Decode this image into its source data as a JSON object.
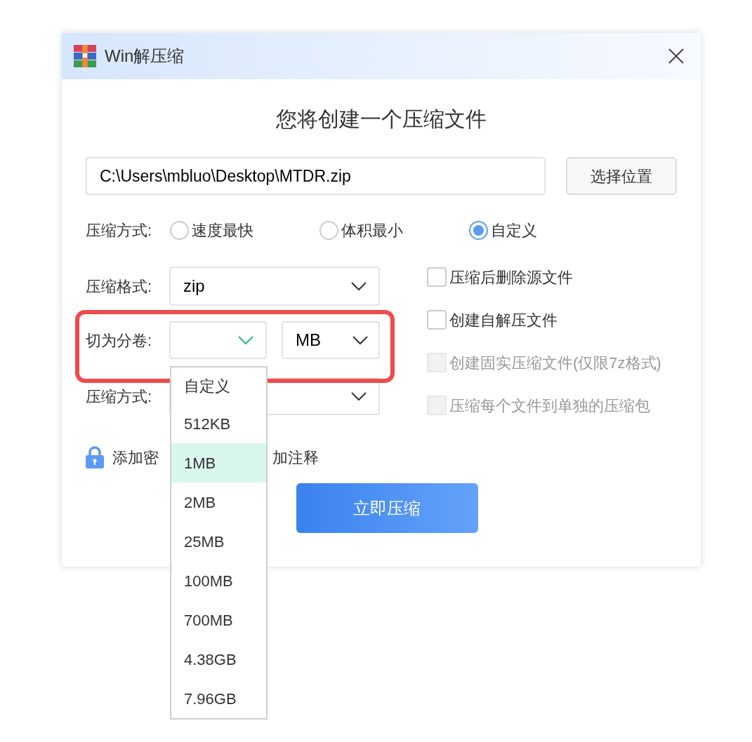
{
  "window": {
    "title": "Win解压缩"
  },
  "heading": "您将创建一个压缩文件",
  "path_field": {
    "value": "C:\\Users\\mbluo\\Desktop\\MTDR.zip"
  },
  "choose_button": "选择位置",
  "mode": {
    "label": "压缩方式:",
    "options": [
      {
        "label": "速度最快",
        "selected": false
      },
      {
        "label": "体积最小",
        "selected": false
      },
      {
        "label": "自定义",
        "selected": true
      }
    ]
  },
  "format": {
    "label": "压缩格式:",
    "value": "zip"
  },
  "split": {
    "label": "切为分卷:",
    "size_open": true,
    "unit": "MB"
  },
  "method": {
    "label": "压缩方式:"
  },
  "checkboxes": [
    {
      "label": "压缩后删除源文件",
      "checked": false,
      "disabled": false
    },
    {
      "label": "创建自解压文件",
      "checked": false,
      "disabled": false
    },
    {
      "label": "创建固实压缩文件(仅限7z格式)",
      "checked": false,
      "disabled": true
    },
    {
      "label": "压缩每个文件到单独的压缩包",
      "checked": false,
      "disabled": true
    }
  ],
  "password_link": "添加密",
  "comment_link": "加注释",
  "compress_button": "立即压缩",
  "split_options": [
    {
      "label": "自定义",
      "selected": false
    },
    {
      "label": "512KB",
      "selected": false
    },
    {
      "label": "1MB",
      "selected": true
    },
    {
      "label": "2MB",
      "selected": false
    },
    {
      "label": "25MB",
      "selected": false
    },
    {
      "label": "100MB",
      "selected": false
    },
    {
      "label": "700MB",
      "selected": false
    },
    {
      "label": "4.38GB",
      "selected": false
    },
    {
      "label": "7.96GB",
      "selected": false
    }
  ]
}
